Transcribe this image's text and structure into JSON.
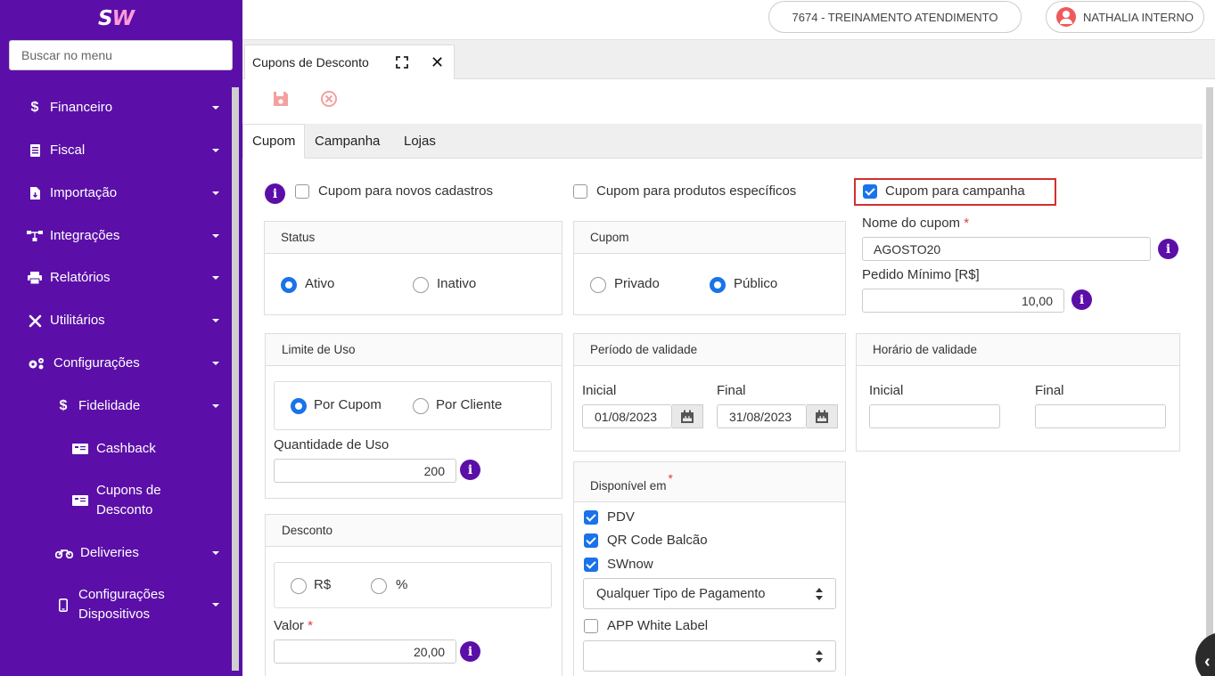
{
  "app": {
    "logo_text": "SW"
  },
  "sidebar": {
    "search_placeholder": "Buscar no menu",
    "items": [
      {
        "label": "Financeiro",
        "icon": "dollar-icon"
      },
      {
        "label": "Fiscal",
        "icon": "document-icon"
      },
      {
        "label": "Importação",
        "icon": "file-import-icon"
      },
      {
        "label": "Integrações",
        "icon": "network-icon"
      },
      {
        "label": "Relatórios",
        "icon": "printer-icon"
      },
      {
        "label": "Utilitários",
        "icon": "tools-icon"
      },
      {
        "label": "Configurações",
        "icon": "gears-icon"
      },
      {
        "label": "Fidelidade",
        "icon": "dollar-icon"
      },
      {
        "label": "Cashback",
        "icon": "ticket-icon"
      },
      {
        "label": "Cupons de Desconto",
        "icon": "ticket-icon"
      },
      {
        "label": "Deliveries",
        "icon": "motorcycle-icon"
      },
      {
        "label": "Configurações Dispositivos",
        "icon": "mobile-icon"
      }
    ]
  },
  "header": {
    "store": "7674 - TREINAMENTO ATENDIMENTO",
    "user": "NATHALIA INTERNO"
  },
  "doc_tab": {
    "title": "Cupons de Desconto"
  },
  "inner_tabs": [
    "Cupom",
    "Campanha",
    "Lojas"
  ],
  "options": {
    "novos_cadastros": {
      "label": "Cupom para novos cadastros",
      "checked": false
    },
    "produtos_especificos": {
      "label": "Cupom para produtos específicos",
      "checked": false
    },
    "campanha": {
      "label": "Cupom para campanha",
      "checked": true
    }
  },
  "status": {
    "title": "Status",
    "options": [
      "Ativo",
      "Inativo"
    ],
    "selected": "Ativo"
  },
  "cupom_tipo": {
    "title": "Cupom",
    "options": [
      "Privado",
      "Público"
    ],
    "selected": "Público"
  },
  "nome_cupom": {
    "label": "Nome do cupom",
    "required": "*",
    "value": "AGOSTO20"
  },
  "pedido_minimo": {
    "label": "Pedido Mínimo [R$]",
    "value": "10,00"
  },
  "limite_uso": {
    "title": "Limite de Uso",
    "options": [
      "Por Cupom",
      "Por Cliente"
    ],
    "selected": "Por Cupom",
    "quantidade_label": "Quantidade de Uso",
    "quantidade_value": "200"
  },
  "periodo_validade": {
    "title": "Período de validade",
    "inicial_label": "Inicial",
    "final_label": "Final",
    "inicial_value": "01/08/2023",
    "final_value": "31/08/2023"
  },
  "horario_validade": {
    "title": "Horário de validade",
    "inicial_label": "Inicial",
    "final_label": "Final",
    "inicial_value": "",
    "final_value": ""
  },
  "desconto": {
    "title": "Desconto",
    "options": [
      "R$",
      "%"
    ],
    "valor_label": "Valor",
    "required": "*",
    "valor_value": "20,00"
  },
  "disponivel_em": {
    "title": "Disponível em",
    "required": "*",
    "channels": [
      {
        "label": "PDV",
        "checked": true
      },
      {
        "label": "QR Code Balcão",
        "checked": true
      },
      {
        "label": "SWnow",
        "checked": true
      }
    ],
    "payment_select": "Qualquer Tipo de Pagamento",
    "white_label": {
      "label": "APP White Label",
      "checked": false
    },
    "white_label_select": ""
  },
  "colors": {
    "sidebar": "#5b0fa8",
    "accent": "#1a73e8",
    "highlight": "#d32f2f",
    "info": "#5b0fa8"
  }
}
